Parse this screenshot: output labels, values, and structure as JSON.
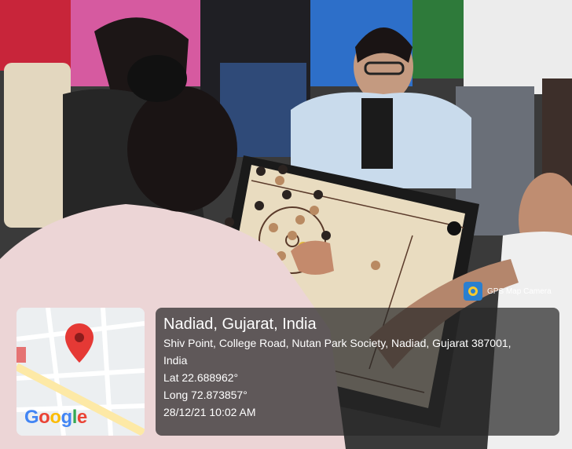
{
  "photo": {
    "description_icon": "carrom-game-photo"
  },
  "badge": {
    "label": "GPS Map Camera",
    "icon": "gps-camera-icon"
  },
  "map": {
    "logo": "Google",
    "icon": "map-pin-icon"
  },
  "location": {
    "title": "Nadiad, Gujarat, India",
    "address_line1": "Shiv Point, College Road, Nutan Park Society, Nadiad, Gujarat 387001,",
    "address_line2": "India",
    "lat": "Lat 22.688962°",
    "long": "Long 72.873857°",
    "datetime": "28/12/21 10:02 AM"
  },
  "colors": {
    "board": "#e9dcc0",
    "pin": "#e53935",
    "panel": "#282828"
  }
}
